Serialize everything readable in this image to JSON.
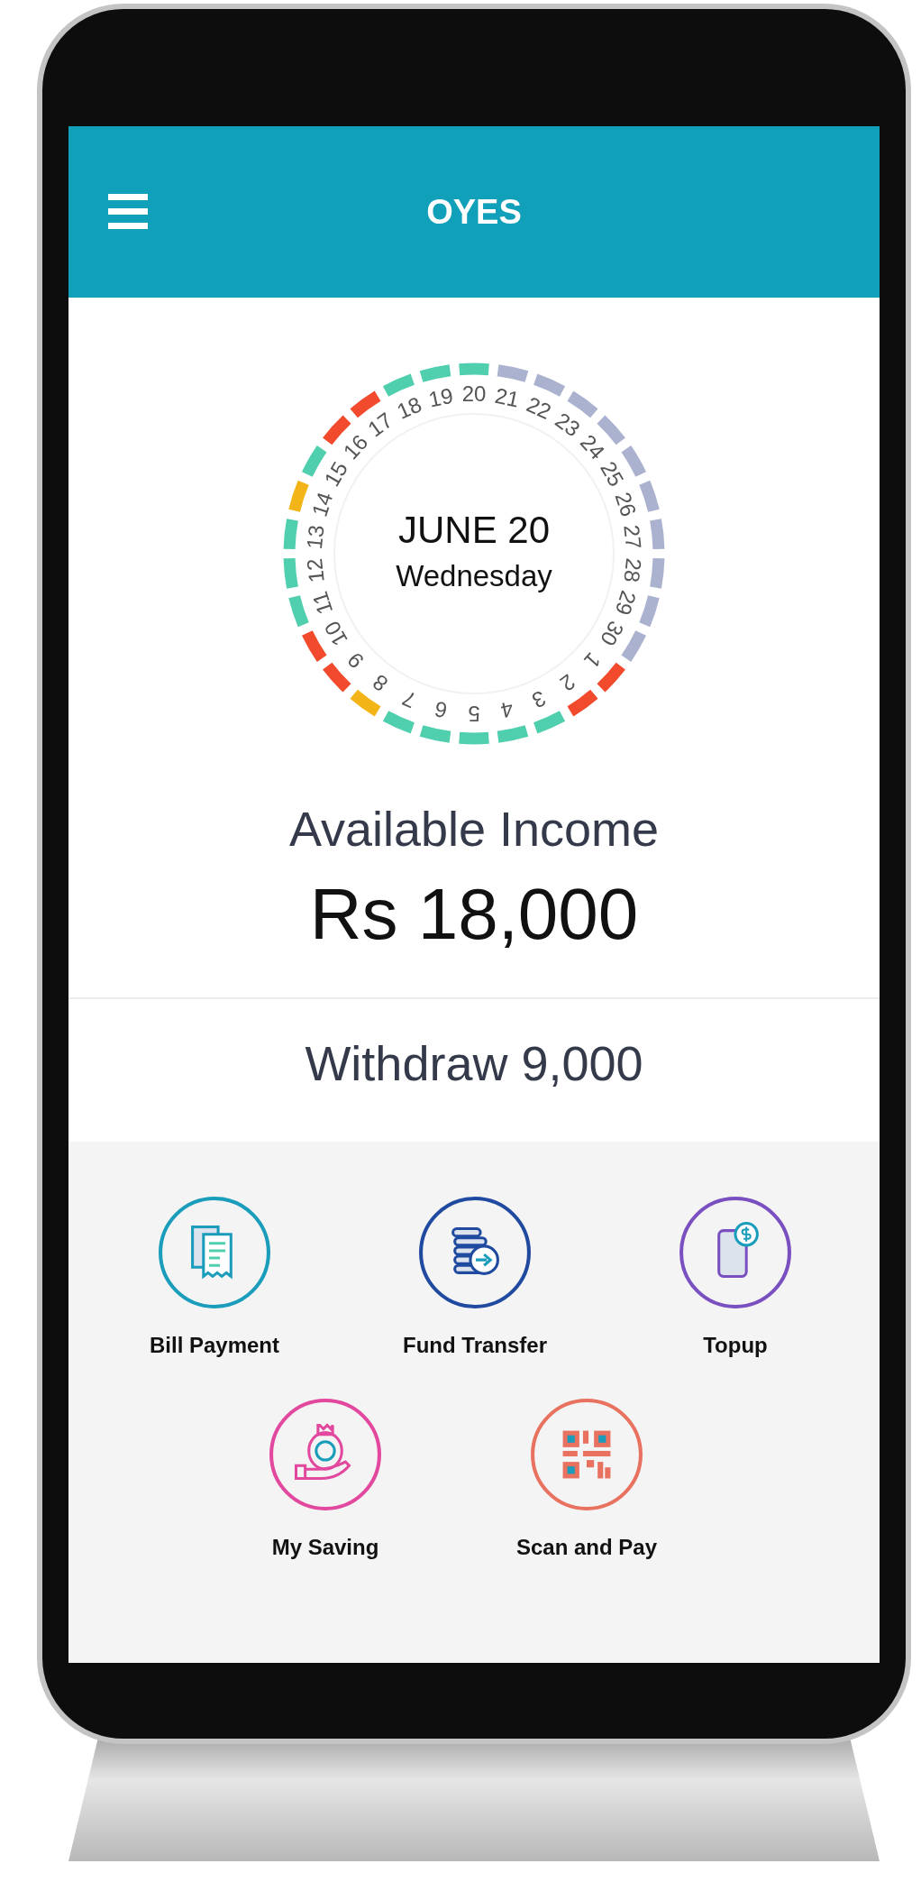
{
  "header": {
    "title": "OYES"
  },
  "calendar": {
    "month_day": "JUNE 20",
    "weekday": "Wednesday",
    "days": [
      {
        "label": "20",
        "color": "#4fcfae"
      },
      {
        "label": "21",
        "color": "#aab2cf"
      },
      {
        "label": "22",
        "color": "#aab2cf"
      },
      {
        "label": "23",
        "color": "#aab2cf"
      },
      {
        "label": "24",
        "color": "#aab2cf"
      },
      {
        "label": "25",
        "color": "#aab2cf"
      },
      {
        "label": "26",
        "color": "#aab2cf"
      },
      {
        "label": "27",
        "color": "#aab2cf"
      },
      {
        "label": "28",
        "color": "#aab2cf"
      },
      {
        "label": "29",
        "color": "#aab2cf"
      },
      {
        "label": "30",
        "color": "#aab2cf"
      },
      {
        "label": "1",
        "color": "#f24a2c"
      },
      {
        "label": "2",
        "color": "#f24a2c"
      },
      {
        "label": "3",
        "color": "#4fcfae"
      },
      {
        "label": "4",
        "color": "#4fcfae"
      },
      {
        "label": "5",
        "color": "#4fcfae"
      },
      {
        "label": "6",
        "color": "#4fcfae"
      },
      {
        "label": "7",
        "color": "#4fcfae"
      },
      {
        "label": "8",
        "color": "#f3b417"
      },
      {
        "label": "9",
        "color": "#f24a2c"
      },
      {
        "label": "10",
        "color": "#f24a2c"
      },
      {
        "label": "11",
        "color": "#4fcfae"
      },
      {
        "label": "12",
        "color": "#4fcfae"
      },
      {
        "label": "13",
        "color": "#4fcfae"
      },
      {
        "label": "14",
        "color": "#f3b417"
      },
      {
        "label": "15",
        "color": "#4fcfae"
      },
      {
        "label": "16",
        "color": "#f24a2c"
      },
      {
        "label": "17",
        "color": "#f24a2c"
      },
      {
        "label": "18",
        "color": "#4fcfae"
      },
      {
        "label": "19",
        "color": "#4fcfae"
      }
    ]
  },
  "income": {
    "label": "Available Income",
    "amount": "Rs 18,000"
  },
  "withdraw": {
    "label": "Withdraw 9,000"
  },
  "actions": [
    [
      {
        "kind": "bill",
        "label": "Bill Payment"
      },
      {
        "kind": "transfer",
        "label": "Fund Transfer"
      },
      {
        "kind": "topup",
        "label": "Topup"
      }
    ],
    [
      {
        "kind": "saving",
        "label": "My Saving"
      },
      {
        "kind": "qr",
        "label": "Scan and Pay"
      }
    ]
  ]
}
